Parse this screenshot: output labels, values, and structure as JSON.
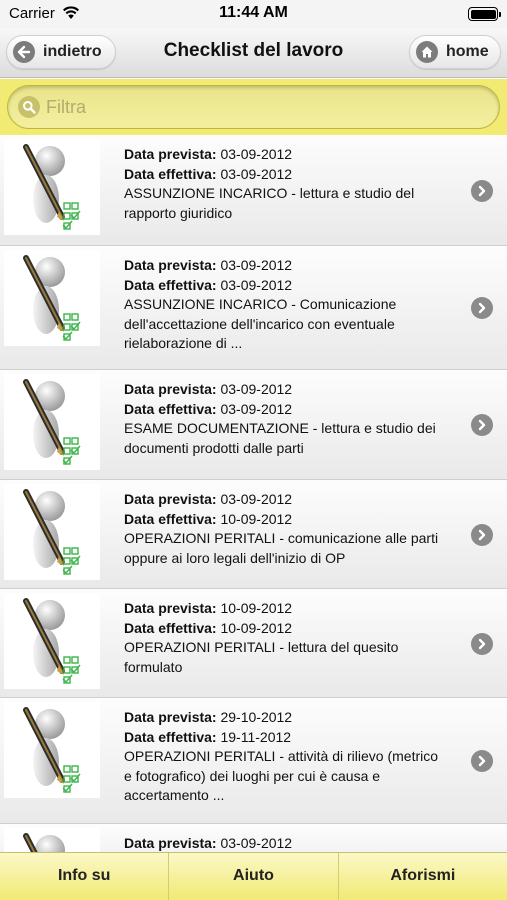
{
  "status": {
    "carrier": "Carrier",
    "time": "11:44 AM"
  },
  "nav": {
    "back_label": "indietro",
    "title": "Checklist del lavoro",
    "home_label": "home"
  },
  "filter": {
    "placeholder": "Filtra"
  },
  "labels": {
    "planned": "Data prevista:",
    "actual": "Data effettiva:"
  },
  "items": [
    {
      "planned": "03-09-2012",
      "actual": "03-09-2012",
      "desc_lines": [
        "ASSUNZIONE INCARICO - lettura e studio del",
        "rapporto giuridico"
      ]
    },
    {
      "planned": "03-09-2012",
      "actual": "03-09-2012",
      "desc_lines": [
        "ASSUNZIONE INCARICO - Comunicazione",
        "dell'accettazione dell'incarico con eventuale",
        "rielaborazione di ..."
      ]
    },
    {
      "planned": "03-09-2012",
      "actual": "03-09-2012",
      "desc_lines": [
        "ESAME DOCUMENTAZIONE - lettura e studio dei",
        "documenti prodotti dalle parti"
      ]
    },
    {
      "planned": "03-09-2012",
      "actual": "10-09-2012",
      "desc_lines": [
        "OPERAZIONI PERITALI - comunicazione alle parti",
        "oppure ai loro legali dell'inizio di OP"
      ]
    },
    {
      "planned": "10-09-2012",
      "actual": "10-09-2012",
      "desc_lines": [
        "OPERAZIONI PERITALI - lettura del quesito",
        "formulato"
      ]
    },
    {
      "planned": "29-10-2012",
      "actual": "19-11-2012",
      "desc_lines": [
        "OPERAZIONI PERITALI - attività di rilievo (metrico",
        "e fotografico) dei luoghi per cui è causa e",
        "accertamento ..."
      ]
    },
    {
      "planned": "03-09-2012",
      "actual": null,
      "desc_lines": []
    }
  ],
  "tabs": [
    "Info su",
    "Aiuto",
    "Aforismi"
  ],
  "colors": {
    "accent_yellow": "#f1ea73",
    "check_green": "#3bb54a"
  }
}
